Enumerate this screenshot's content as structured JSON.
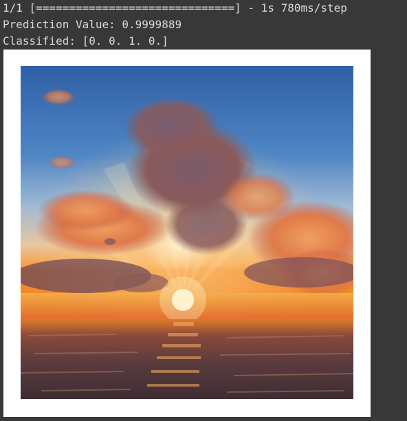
{
  "console": {
    "progress_line": "1/1 [==============================] - 1s 780ms/step",
    "prediction_line": "Prediction Value: 0.9999889",
    "classified_line": "Classified: [0. 0. 1. 0.]"
  },
  "figure": {
    "image_subject": "sunset-over-sea-photo"
  },
  "colors": {
    "console_background": "#383838",
    "console_text": "#d9d9d9",
    "figure_background": "#ffffff"
  }
}
